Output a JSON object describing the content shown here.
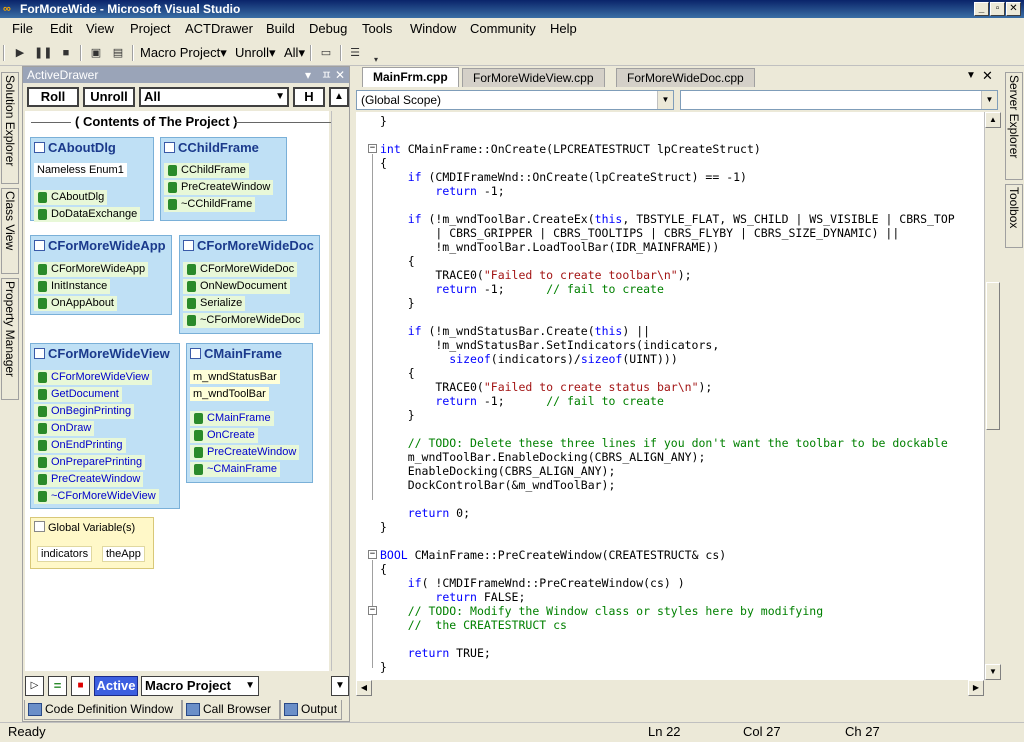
{
  "window": {
    "title": "ForMoreWide - Microsoft Visual Studio",
    "minimize": "_",
    "restore": "▫",
    "close": "✕"
  },
  "menu": [
    "File",
    "Edit",
    "View",
    "Project",
    "ACTDrawer",
    "Build",
    "Debug",
    "Tools",
    "Window",
    "Community",
    "Help"
  ],
  "toolbar": {
    "macro_project": "Macro Project",
    "unroll": "Unroll",
    "all": "All"
  },
  "left_tabs": [
    "Solution Explorer",
    "Class View",
    "Property Manager"
  ],
  "right_tabs": [
    "Server Explorer",
    "Toolbox"
  ],
  "drawer": {
    "title": "ActiveDrawer",
    "pin": "ㅍ",
    "close": "✕",
    "roll": "Roll",
    "unroll": "Unroll",
    "filter": "All",
    "h": "H",
    "header": "( Contents of The Project )",
    "classes": [
      {
        "name": "CAboutDlg",
        "fields": [
          "Nameless Enum1"
        ],
        "methods": [
          "CAboutDlg",
          "DoDataExchange"
        ]
      },
      {
        "name": "CChildFrame",
        "fields": [],
        "methods": [
          "CChildFrame",
          "PreCreateWindow",
          "~CChildFrame"
        ]
      },
      {
        "name": "CForMoreWideApp",
        "fields": [],
        "methods": [
          "CForMoreWideApp",
          "InitInstance",
          "OnAppAbout"
        ]
      },
      {
        "name": "CForMoreWideDoc",
        "fields": [],
        "methods": [
          "CForMoreWideDoc",
          "OnNewDocument",
          "Serialize",
          "~CForMoreWideDoc"
        ]
      },
      {
        "name": "CForMoreWideView",
        "fields": [],
        "methods": [
          "CForMoreWideView",
          "GetDocument",
          "OnBeginPrinting",
          "OnDraw",
          "OnEndPrinting",
          "OnPreparePrinting",
          "PreCreateWindow",
          "~CForMoreWideView"
        ]
      },
      {
        "name": "CMainFrame",
        "fields": [
          "m_wndStatusBar",
          "m_wndToolBar"
        ],
        "methods": [
          "CMainFrame",
          "OnCreate",
          "PreCreateWindow",
          "~CMainFrame"
        ]
      }
    ],
    "globals": {
      "title": "Global Variable(s)",
      "items": [
        "indicators",
        "theApp"
      ]
    },
    "bottom": {
      "active": "Active",
      "macro": "Macro Project"
    }
  },
  "bottom_tabs": [
    "Code Definition Window",
    "Call Browser",
    "Output"
  ],
  "editor": {
    "tabs": [
      "MainFrm.cpp",
      "ForMoreWideView.cpp",
      "ForMoreWideDoc.cpp"
    ],
    "scope": "(Global Scope)",
    "member": "",
    "lines": [
      "}",
      "",
      "int CMainFrame::OnCreate(LPCREATESTRUCT lpCreateStruct)",
      "{",
      "    if (CMDIFrameWnd::OnCreate(lpCreateStruct) == -1)",
      "        return -1;",
      "",
      "    if (!m_wndToolBar.CreateEx(this, TBSTYLE_FLAT, WS_CHILD | WS_VISIBLE | CBRS_TOP",
      "        | CBRS_GRIPPER | CBRS_TOOLTIPS | CBRS_FLYBY | CBRS_SIZE_DYNAMIC) ||",
      "        !m_wndToolBar.LoadToolBar(IDR_MAINFRAME))",
      "    {",
      "        TRACE0(\"Failed to create toolbar\\n\");",
      "        return -1;      // fail to create",
      "    }",
      "",
      "    if (!m_wndStatusBar.Create(this) ||",
      "        !m_wndStatusBar.SetIndicators(indicators,",
      "          sizeof(indicators)/sizeof(UINT)))",
      "    {",
      "        TRACE0(\"Failed to create status bar\\n\");",
      "        return -1;      // fail to create",
      "    }",
      "",
      "    // TODO: Delete these three lines if you don't want the toolbar to be dockable",
      "    m_wndToolBar.EnableDocking(CBRS_ALIGN_ANY);",
      "    EnableDocking(CBRS_ALIGN_ANY);",
      "    DockControlBar(&m_wndToolBar);",
      "",
      "    return 0;",
      "}",
      "",
      "BOOL CMainFrame::PreCreateWindow(CREATESTRUCT& cs)",
      "{",
      "    if( !CMDIFrameWnd::PreCreateWindow(cs) )",
      "        return FALSE;",
      "    // TODO: Modify the Window class or styles here by modifying",
      "    //  the CREATESTRUCT cs",
      "",
      "    return TRUE;",
      "}"
    ]
  },
  "status": {
    "ready": "Ready",
    "ln": "Ln 22",
    "col": "Col 27",
    "ch": "Ch 27"
  },
  "colors": {
    "keyword": "#0000ff",
    "string": "#a31515",
    "comment": "#008000",
    "class_box": "#bfe0f5"
  }
}
